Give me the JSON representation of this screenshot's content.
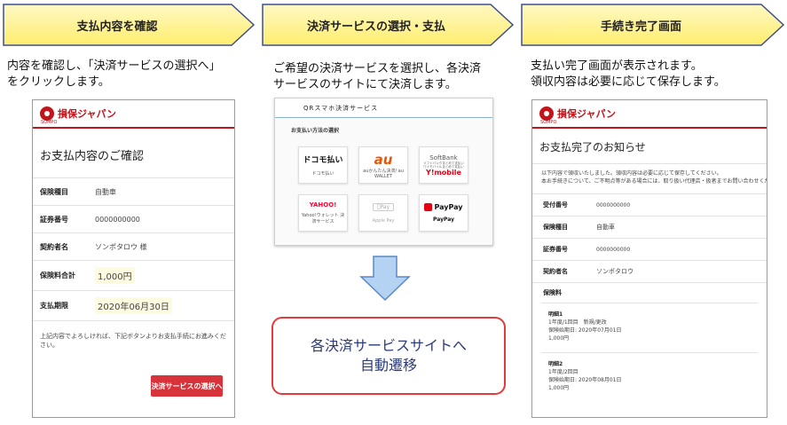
{
  "steps": [
    {
      "label": "支払内容を確認",
      "desc1": "内容を確認し、「決済サービスの選択へ」",
      "desc2": "をクリックします。"
    },
    {
      "label": "決済サービスの選択・支払",
      "desc1": "ご希望の決済サービスを選択し、各決済",
      "desc2": "サービスのサイトにて決済します。"
    },
    {
      "label": "手続き完了画面",
      "desc1": "支払い完了画面が表示されます。",
      "desc2": "領収内容は必要に応じて保存します。"
    }
  ],
  "brand": {
    "name": "損保ジャパン",
    "sub": "SOMPO"
  },
  "confirm": {
    "title": "お支払内容のご確認",
    "rows": [
      {
        "label": "保険種目",
        "value": "自動車"
      },
      {
        "label": "証券番号",
        "value": "0000000000"
      },
      {
        "label": "契約者名",
        "value": "ソンポタロウ 様"
      },
      {
        "label": "保険料合計",
        "value": "1,000円"
      },
      {
        "label": "支払期限",
        "value": "2020年06月30日"
      }
    ],
    "note": "上記内容でよろしければ、下記ボタンよりお支払手続にお進みください。",
    "button": "決済サービスの選択へ"
  },
  "payselect": {
    "header": "QRスマホ決済サービス",
    "subheader": "お支払い方法の選択",
    "tiles": [
      {
        "logo": "ドコモ払い",
        "caption": "ドコモ払い"
      },
      {
        "logo": "au",
        "caption": "auかんたん決済/ au WALLET"
      },
      {
        "logo": "SoftBank",
        "logo2": "Y!mobile",
        "caption": "ソフトバンクまとめて支払い ワイモバイルまとめて支払い"
      },
      {
        "logo": "YAHOO!",
        "caption": "Yahoo!ウォレット 決済サービス"
      },
      {
        "logo": "Pay",
        "caption": "Apple Pay"
      },
      {
        "logo": "PayPay",
        "caption": "PayPay"
      }
    ]
  },
  "transition": {
    "line1": "各決済サービスサイトへ",
    "line2": "自動遷移"
  },
  "complete": {
    "title": "お支払完了のお知らせ",
    "msg1": "以下内容で領収いたしました。領収内容は必要に応じて保存してください。",
    "msg2": "本お手続きについて、ご不明点等がある場合には、取り扱い代理店・扱者までお問い合わせください。",
    "rows": [
      {
        "label": "受付番号",
        "value": "0000000000"
      },
      {
        "label": "保険種目",
        "value": "自動車"
      },
      {
        "label": "証券番号",
        "value": "0000000000"
      },
      {
        "label": "契約者名",
        "value": "ソンポタロウ"
      }
    ],
    "premium_label": "保険料",
    "items": [
      {
        "title": "明細1",
        "l1": "1年度/1回目　新規/更改",
        "l2": "保険始期日: 2020年07月01日",
        "l3": "1,000円"
      },
      {
        "title": "明細2",
        "l1": "1年度/2回目",
        "l2": "保険始期日: 2020年08月01日",
        "l3": "1,000円"
      }
    ]
  },
  "colors": {
    "accent": "#c4141b",
    "chevron": "#fff07a",
    "border_blue": "#3e4f8e",
    "arrow": "#a8c8ee",
    "result_border": "#e23b3b"
  }
}
